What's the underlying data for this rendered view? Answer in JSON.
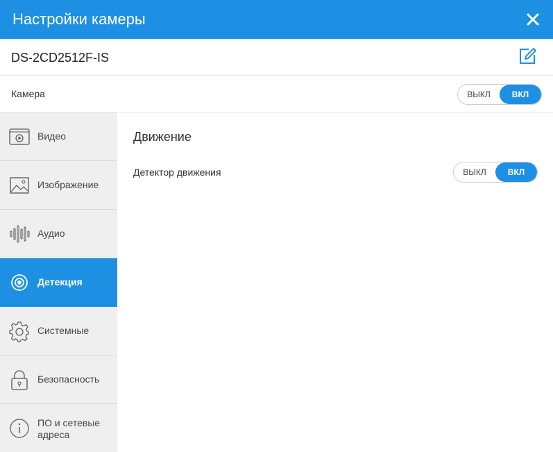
{
  "window": {
    "title": "Настройки камеры",
    "close_icon": "close-icon"
  },
  "device": {
    "name": "DS-2CD2512F-IS",
    "edit_icon": "edit-icon"
  },
  "camera": {
    "label": "Камера",
    "toggle": {
      "off_label": "ВЫКЛ",
      "on_label": "ВКЛ",
      "state": "on"
    }
  },
  "sidebar": {
    "items": [
      {
        "label": "Видео",
        "icon": "video-icon",
        "active": false
      },
      {
        "label": "Изображение",
        "icon": "image-icon",
        "active": false
      },
      {
        "label": "Аудио",
        "icon": "audio-waveform-icon",
        "active": false
      },
      {
        "label": "Детекция",
        "icon": "detection-target-icon",
        "active": true
      },
      {
        "label": "Системные",
        "icon": "gear-icon",
        "active": false
      },
      {
        "label": "Безопасность",
        "icon": "lock-icon",
        "active": false
      },
      {
        "label": "ПО и сетевые адреса",
        "icon": "info-icon",
        "active": false
      }
    ]
  },
  "main": {
    "section_title": "Движение",
    "motion_detector": {
      "label": "Детектор движения",
      "toggle": {
        "off_label": "ВЫКЛ",
        "on_label": "ВКЛ",
        "state": "on"
      }
    }
  },
  "colors": {
    "accent": "#1e90e3",
    "sidebar_bg": "#efefef"
  }
}
